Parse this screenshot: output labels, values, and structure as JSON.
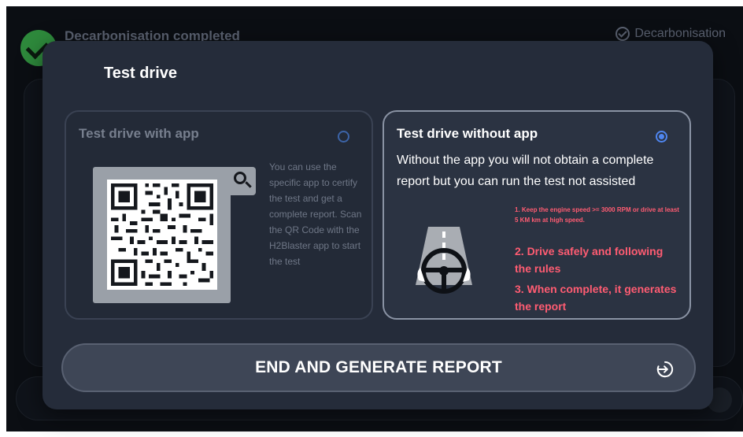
{
  "background": {
    "title": "Decarbonisation completed",
    "status_label": "Decarbonisation"
  },
  "modal": {
    "title": "Test drive",
    "option_with_app": {
      "title": "Test drive with app",
      "selected": false,
      "description": "You can use the specific app to certify the test and get a complete report. Scan the QR Code with the H2Blaster app to start the test",
      "qr_icon": "qr-code-icon",
      "zoom_icon": "search-icon"
    },
    "option_without_app": {
      "title": "Test drive without app",
      "selected": true,
      "description": "Without the app you will not obtain a complete report but you can run the test not assisted",
      "illustration_icon": "steering-wheel-road-icon",
      "rules": [
        "1. Keep the engine speed >= 3000 RPM or drive at least 5 KM km at high speed.",
        "2. Drive safely and following the rules",
        "3. When complete, it generates the report"
      ]
    },
    "end_button": {
      "label": "END AND GENERATE REPORT",
      "icon": "enter-icon"
    }
  },
  "colors": {
    "modal_bg": "#252c3a",
    "rule_text": "#ff5c72",
    "radio_accent": "#4f86f0",
    "success_green": "#2e8a3c"
  }
}
